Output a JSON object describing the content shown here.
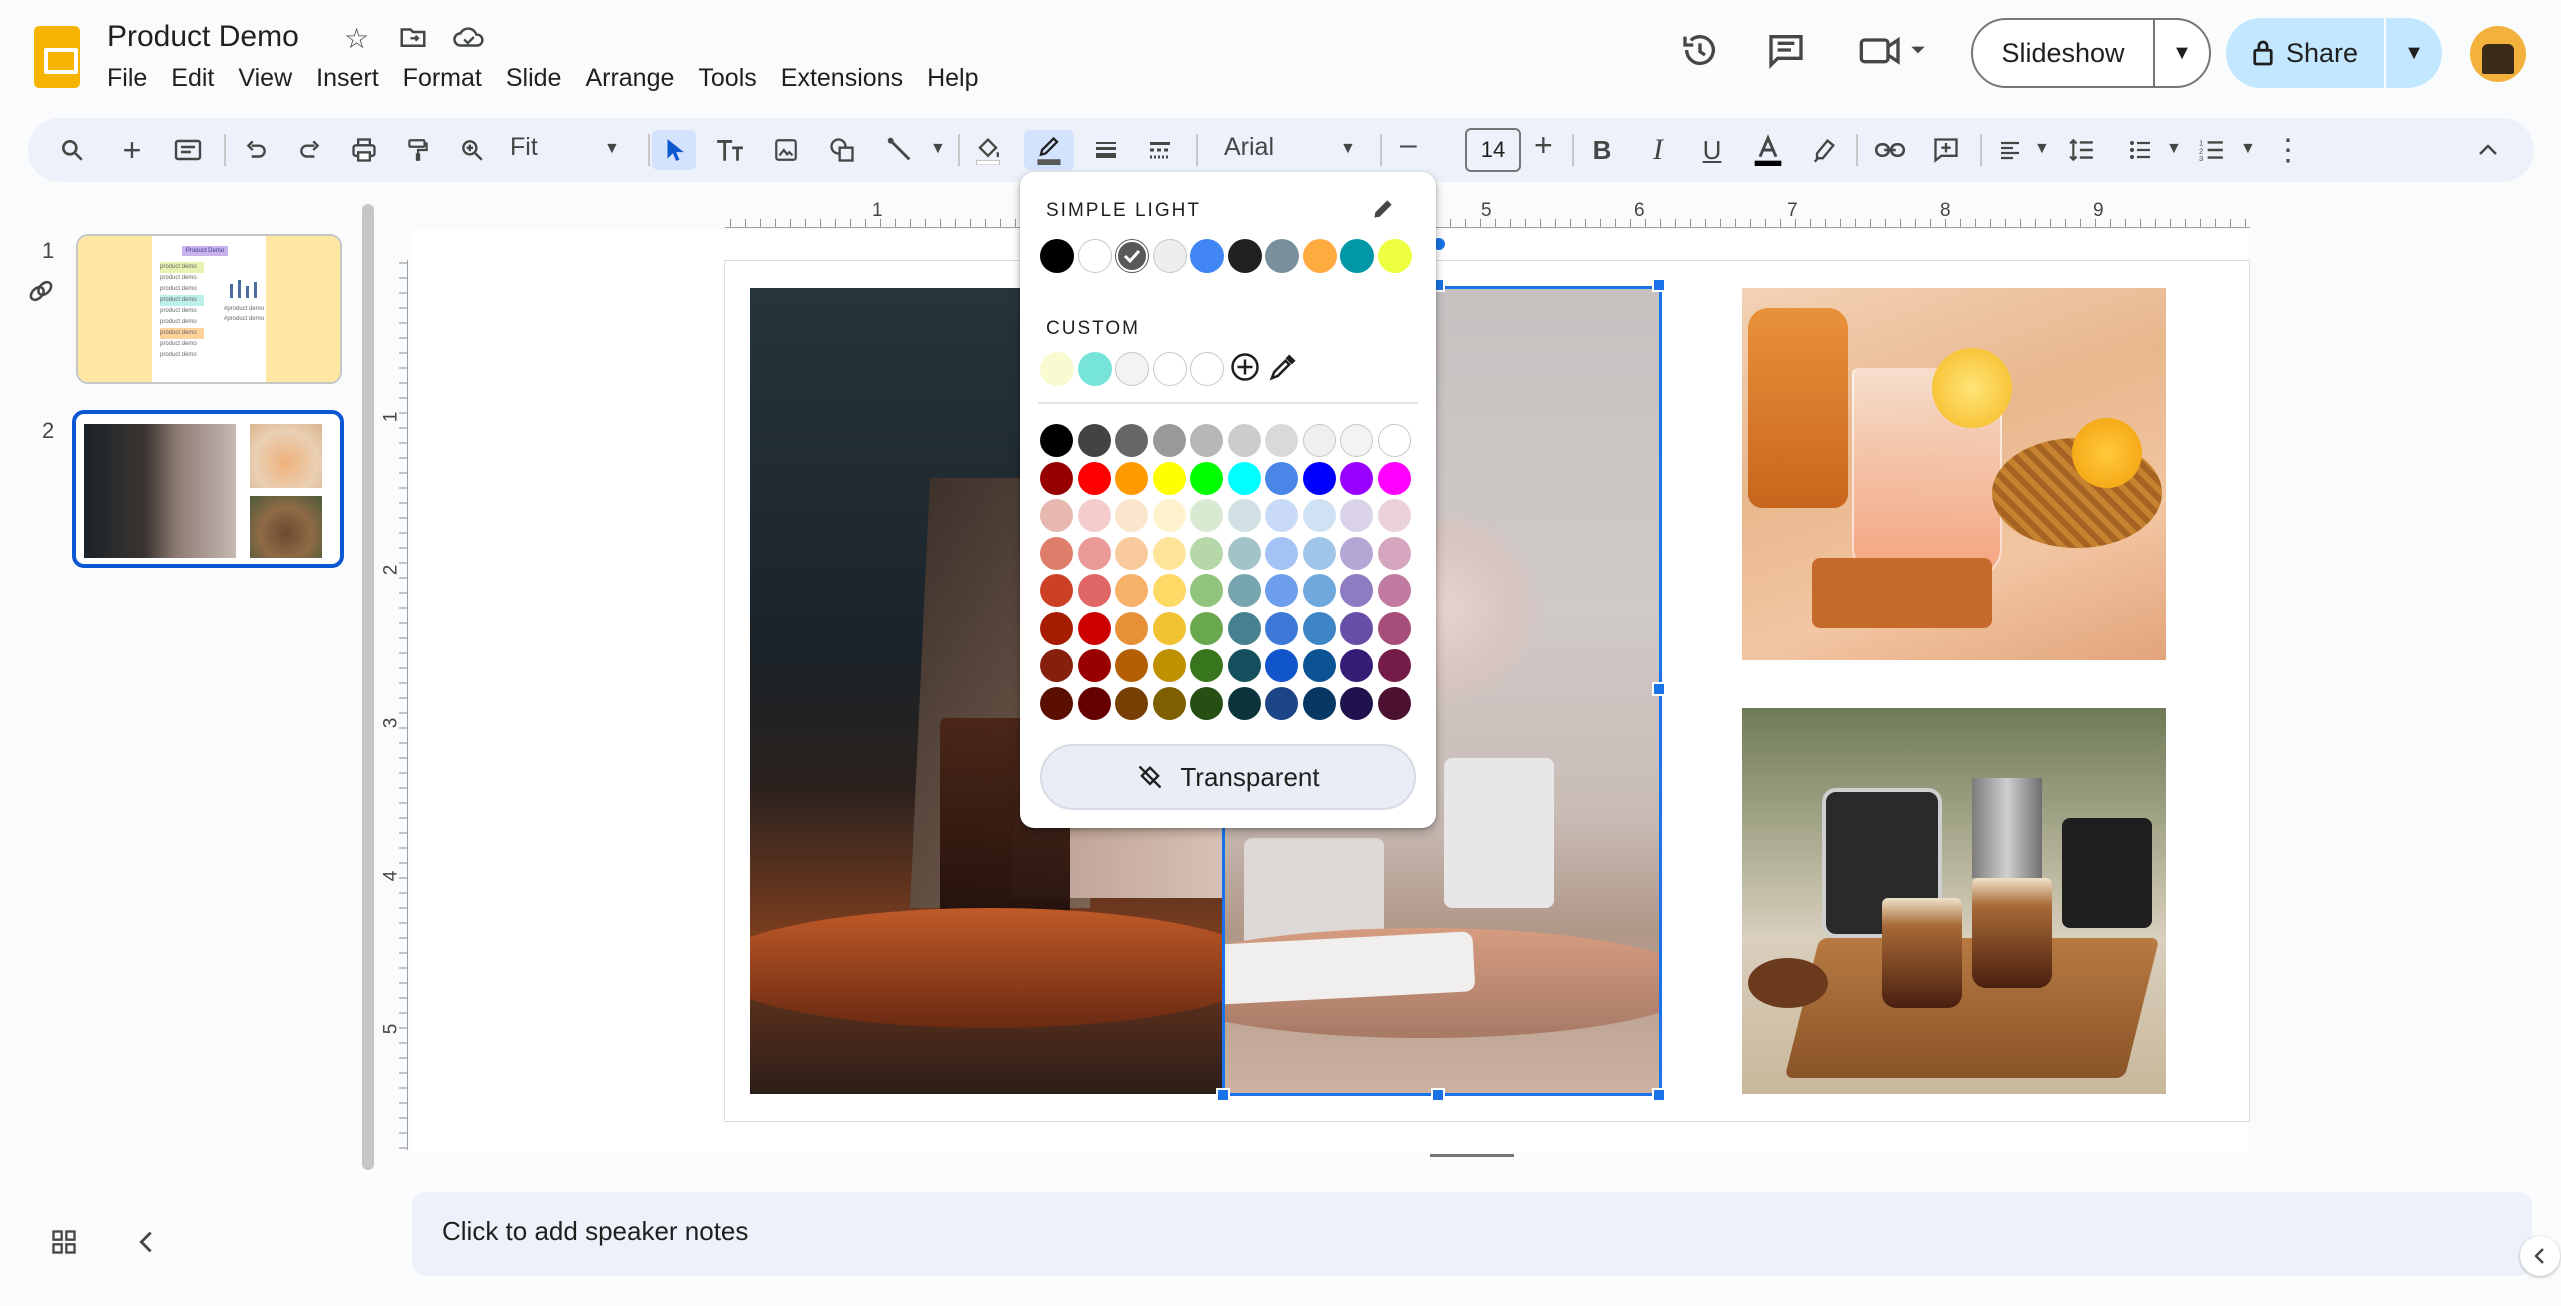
{
  "app": {
    "title": "Product Demo",
    "menu": [
      "File",
      "Edit",
      "View",
      "Insert",
      "Format",
      "Slide",
      "Arrange",
      "Tools",
      "Extensions",
      "Help"
    ],
    "slideshow_label": "Slideshow",
    "share_label": "Share"
  },
  "toolbar": {
    "zoom": "Fit",
    "font": "Arial",
    "font_size": "14",
    "minus": "–",
    "plus": "+"
  },
  "filmstrip": {
    "slides": [
      {
        "number": "1",
        "title": "Product Demo",
        "lines": [
          "product demo",
          "product demo",
          "product demo",
          "product demo",
          "product demo",
          "product demo",
          "product demo",
          "product demo",
          "product demo"
        ],
        "chart_labels": [
          "#product demo",
          "#product demo"
        ]
      },
      {
        "number": "2"
      }
    ]
  },
  "rulers": {
    "horizontal": [
      "1",
      "5",
      "6",
      "7",
      "8",
      "9"
    ],
    "vertical": [
      "1",
      "2",
      "3",
      "4",
      "5"
    ]
  },
  "color_picker": {
    "theme_heading": "SIMPLE LIGHT",
    "custom_heading": "CUSTOM",
    "transparent_label": "Transparent",
    "theme_colors": [
      "#000000",
      "#ffffff",
      "#595959",
      "#eeeeee",
      "#4285f4",
      "#212121",
      "#78909c",
      "#ffab40",
      "#0097a7",
      "#eeff41"
    ],
    "selected_theme_color": "#595959",
    "custom_colors": [
      "#f7fbcf",
      "#76e4d8",
      "#f3f3f3",
      "#ffffff",
      "#ffffff"
    ],
    "grid": [
      [
        "#000000",
        "#434343",
        "#666666",
        "#999999",
        "#b7b7b7",
        "#cccccc",
        "#d9d9d9",
        "#efefef",
        "#f3f3f3",
        "#ffffff"
      ],
      [
        "#980000",
        "#ff0000",
        "#ff9900",
        "#ffff00",
        "#00ff00",
        "#00ffff",
        "#4a86e8",
        "#0000ff",
        "#9900ff",
        "#ff00ff"
      ],
      [
        "#e6b8af",
        "#f4cccc",
        "#fce5cd",
        "#fff2cc",
        "#d9ead3",
        "#d0e0e3",
        "#c9daf8",
        "#cfe2f3",
        "#d9d2e9",
        "#ead1dc"
      ],
      [
        "#dd7e6b",
        "#ea9999",
        "#f9cb9c",
        "#ffe599",
        "#b6d7a8",
        "#a2c4c9",
        "#a4c2f4",
        "#9fc5e8",
        "#b4a7d6",
        "#d5a6bd"
      ],
      [
        "#cc4125",
        "#e06666",
        "#f6b26b",
        "#ffd966",
        "#93c47d",
        "#76a5af",
        "#6d9eeb",
        "#6fa8dc",
        "#8e7cc3",
        "#c27ba0"
      ],
      [
        "#a61c00",
        "#cc0000",
        "#e69138",
        "#f1c232",
        "#6aa84f",
        "#45818e",
        "#3c78d8",
        "#3d85c6",
        "#674ea7",
        "#a64d79"
      ],
      [
        "#85200c",
        "#990000",
        "#b45f06",
        "#bf9000",
        "#38761d",
        "#134f5c",
        "#1155cc",
        "#0b5394",
        "#351c75",
        "#741b47"
      ],
      [
        "#5b0f00",
        "#660000",
        "#783f04",
        "#7f6000",
        "#274e13",
        "#0c343d",
        "#1c4587",
        "#073763",
        "#20124d",
        "#4c1130"
      ]
    ]
  },
  "notes": {
    "placeholder": "Click to add speaker notes"
  }
}
